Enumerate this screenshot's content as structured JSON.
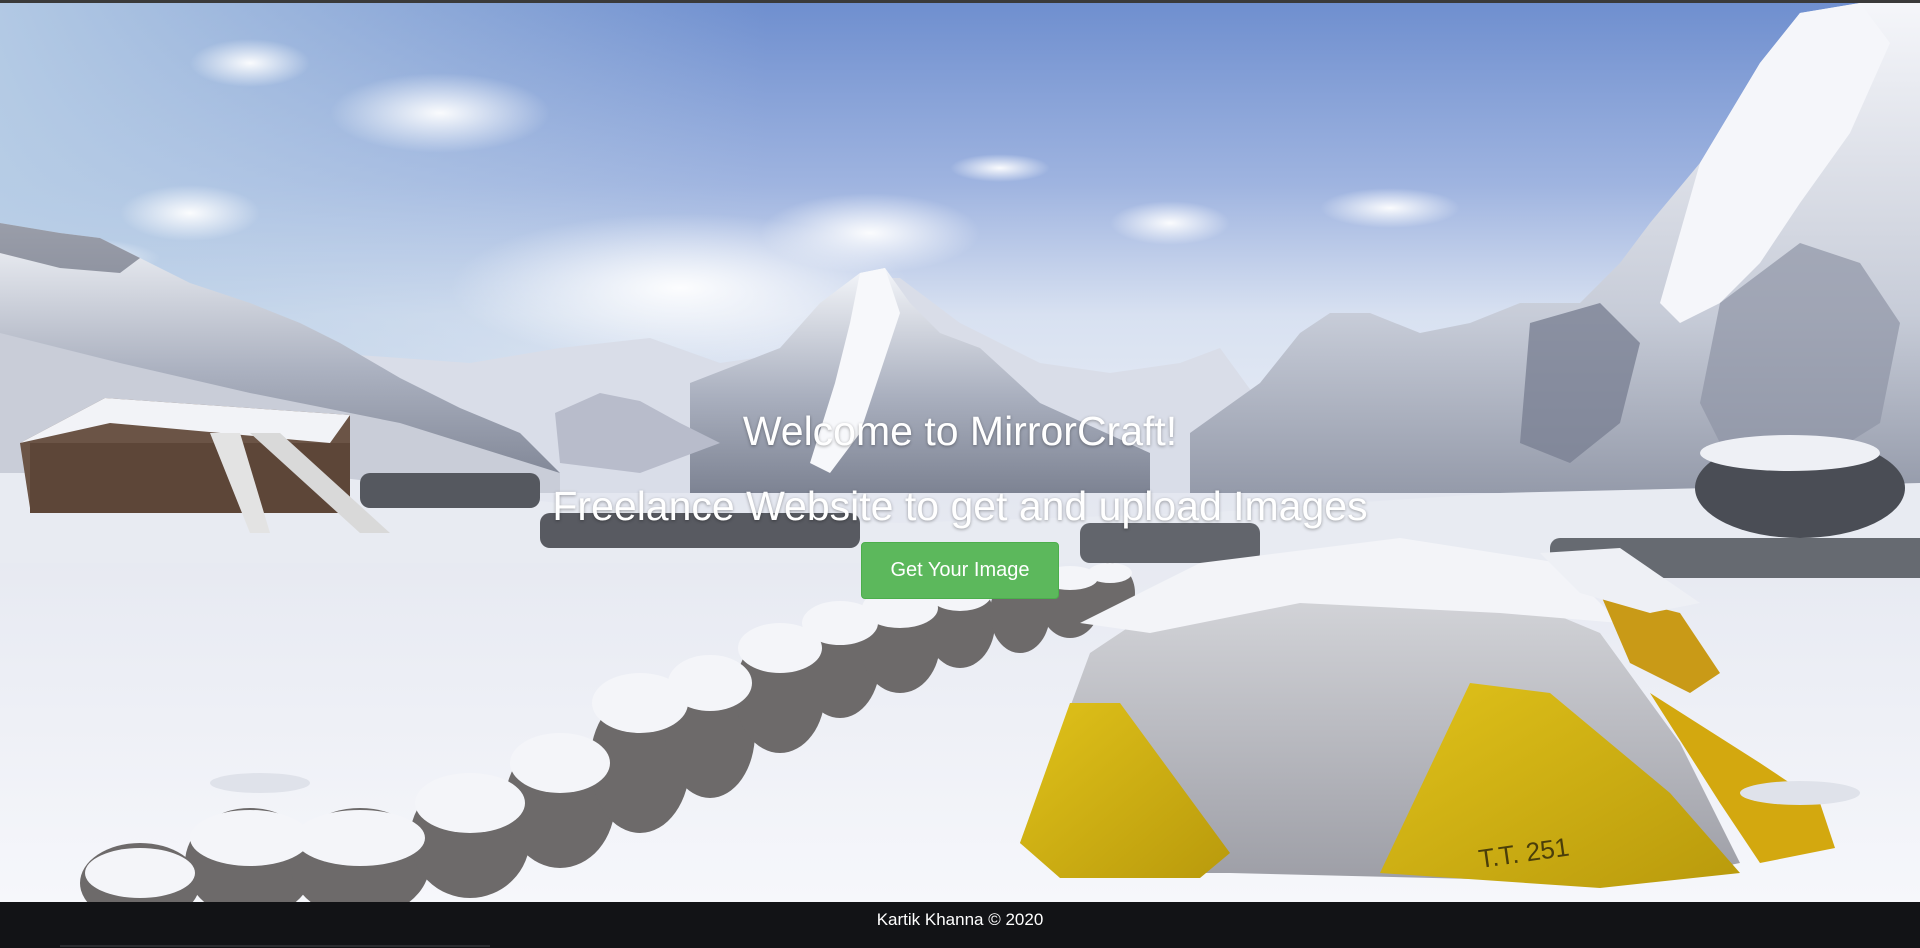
{
  "hero": {
    "title": "Welcome to MirrorCraft!",
    "subtitle": "Freelance Website to get and upload Images",
    "cta_label": "Get Your Image",
    "background": "snowy Himalayan camp with mountains and yellow tents",
    "colors": {
      "cta": "#5cb85c",
      "text": "#ffffff"
    }
  },
  "footer": {
    "text": "Kartik Khanna © 2020"
  }
}
